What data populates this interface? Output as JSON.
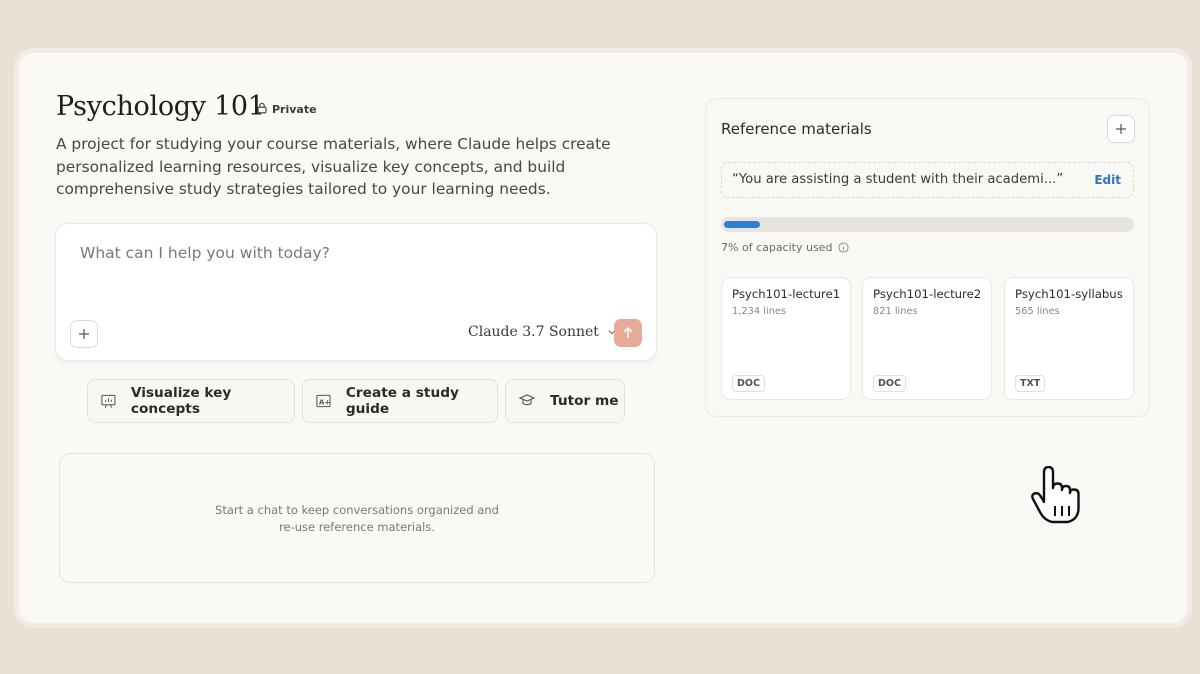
{
  "project": {
    "title": "Psychology 101",
    "visibility": "Private",
    "description": "A project for studying your course materials, where Claude helps create personalized learning resources, visualize key concepts, and build comprehensive study strategies tailored to your learning needs."
  },
  "composer": {
    "placeholder": "What can I help you with today?",
    "model": "Claude 3.7 Sonnet"
  },
  "suggestions": [
    {
      "label": "Visualize key concepts",
      "icon": "presentation-chart-icon"
    },
    {
      "label": "Create a study guide",
      "icon": "grade-a-plus-icon"
    },
    {
      "label": "Tutor me",
      "icon": "graduation-cap-icon"
    }
  ],
  "empty_state": {
    "line1": "Start a chat to keep conversations organized and",
    "line2": "re-use reference materials."
  },
  "reference": {
    "title": "Reference materials",
    "instructions_preview": "“You are assisting a student with their academi...”",
    "edit_label": "Edit",
    "capacity_text": "7% of capacity used",
    "capacity_fraction": 0.07,
    "files": [
      {
        "name": "Psych101-lecture1",
        "lines": "1,234 lines",
        "type": "DOC"
      },
      {
        "name": "Psych101-lecture2",
        "lines": "821 lines",
        "type": "DOC"
      },
      {
        "name": "Psych101-syllabus",
        "lines": "565 lines",
        "type": "TXT"
      }
    ]
  },
  "colors": {
    "accent_send": "#e7ac98",
    "progress": "#2f7fd1",
    "edit_link": "#2f74b5"
  }
}
